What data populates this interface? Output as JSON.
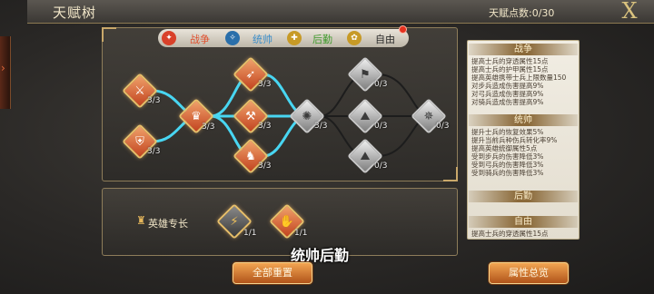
{
  "window": {
    "title": "天赋树",
    "points": "天赋点数:0/30",
    "close_glyph": "X"
  },
  "tabs": [
    {
      "label": "战争",
      "icon": "war-icon",
      "color": "#e0502e",
      "icon_color": "#d9412a",
      "glyph": "✦"
    },
    {
      "label": "统帅",
      "icon": "command-icon",
      "color": "#3a8dc9",
      "icon_color": "#2a6faa",
      "glyph": "✧"
    },
    {
      "label": "后勤",
      "icon": "logistics-icon",
      "color": "#3d9a2a",
      "icon_color": "#c79a26",
      "glyph": "✚"
    },
    {
      "label": "自由",
      "icon": "freedom-icon",
      "color": "#2b2b2b",
      "icon_color": "#c79a26",
      "glyph": "✿"
    }
  ],
  "tree": {
    "nodes": [
      {
        "id": "n1",
        "glyph": "⚔",
        "count": "3/3",
        "active": true
      },
      {
        "id": "n2",
        "glyph": "⛨",
        "count": "3/3",
        "active": true
      },
      {
        "id": "n3",
        "glyph": "♛",
        "count": "3/3",
        "active": true
      },
      {
        "id": "n4",
        "glyph": "➶",
        "count": "3/3",
        "active": true
      },
      {
        "id": "n5",
        "glyph": "⚒",
        "count": "3/3",
        "active": true
      },
      {
        "id": "n6",
        "glyph": "♞",
        "count": "3/3",
        "active": true
      },
      {
        "id": "n7",
        "glyph": "✺",
        "count": "3/3",
        "active": false
      },
      {
        "id": "n8",
        "glyph": "⚑",
        "count": "0/3",
        "active": false
      },
      {
        "id": "n9",
        "glyph": "⛰",
        "count": "0/3",
        "active": false
      },
      {
        "id": "n10",
        "glyph": "⛰",
        "count": "0/3",
        "active": false
      },
      {
        "id": "n11",
        "glyph": "✵",
        "count": "0/3",
        "active": false
      }
    ],
    "link_color": "#48d6f2"
  },
  "hero": {
    "label": "英雄专长",
    "icon": "helmet-icon",
    "skills": [
      {
        "glyph": "⚡",
        "count": "1/1"
      },
      {
        "glyph": "✋",
        "count": "1/1"
      }
    ]
  },
  "subtitle": "统帅后勤",
  "buttons": {
    "reset": "全部重置",
    "overview": "属性总览"
  },
  "info": {
    "sections": [
      {
        "heading": "战争",
        "lines": [
          "提高士兵的穿透属性15点",
          "提高士兵的护甲属性15点",
          "提高英雄携带士兵上限数量150",
          "对步兵造成伤害提高9%",
          "对弓兵造成伤害提高9%",
          "对骑兵造成伤害提高9%"
        ]
      },
      {
        "heading": "统帅",
        "lines": [
          "提升士兵的恢复效果5%",
          "提升当前兵种伤兵转化率9%",
          "提高英雄统御属性5点",
          "受到步兵的伤害降低3%",
          "受到弓兵的伤害降低3%",
          "受到骑兵的伤害降低3%"
        ]
      },
      {
        "heading": "后勤",
        "lines": []
      },
      {
        "heading": "自由",
        "lines": [
          "提高士兵的穿透属性15点"
        ]
      }
    ]
  }
}
